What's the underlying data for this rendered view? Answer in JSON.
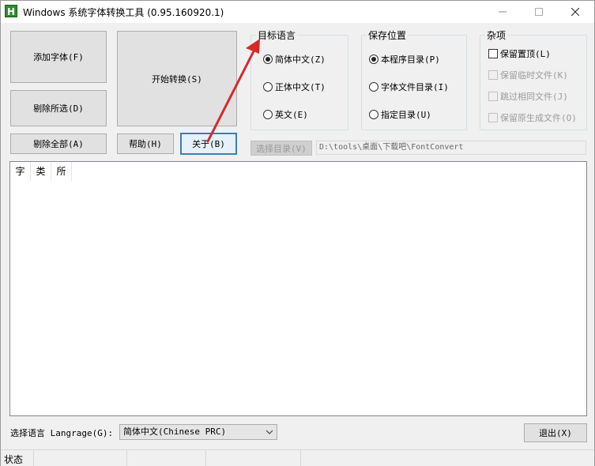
{
  "window": {
    "title": "Windows 系统字体转换工具 (0.95.160920.1)",
    "icon": "app-h-icon",
    "icon_glyph": "H",
    "controls": [
      "minimize-icon",
      "maximize-icon",
      "close-icon"
    ]
  },
  "buttons": {
    "add_font": "添加字体(F)",
    "start_convert": "开始转换(S)",
    "remove_selected": "剔除所选(D)",
    "remove_all": "剔除全部(A)",
    "help": "帮助(H)",
    "about": "关于(B)",
    "choose_dir": "选择目录(V)",
    "exit": "退出(X)"
  },
  "target_language": {
    "title": "目标语言",
    "options": [
      {
        "label": "简体中文(Z)",
        "selected": true
      },
      {
        "label": "正体中文(T)",
        "selected": false
      },
      {
        "label": "英文(E)",
        "selected": false
      }
    ]
  },
  "save_location": {
    "title": "保存位置",
    "options": [
      {
        "label": "本程序目录(P)",
        "selected": true
      },
      {
        "label": "字体文件目录(I)",
        "selected": false
      },
      {
        "label": "指定目录(U)",
        "selected": false
      }
    ]
  },
  "misc": {
    "title": "杂项",
    "options": [
      {
        "label": "保留置顶(L)",
        "checked": false,
        "enabled": true
      },
      {
        "label": "保留临时文件(K)",
        "checked": false,
        "enabled": false
      },
      {
        "label": "跳过相同文件(J)",
        "checked": false,
        "enabled": false
      },
      {
        "label": "保留原生成文件(O)",
        "checked": false,
        "enabled": false
      }
    ]
  },
  "output_path": "D:\\tools\\桌面\\下载吧\\FontConvert",
  "file_list": {
    "columns": [
      "字",
      "类",
      "所"
    ],
    "rows": []
  },
  "ui_language": {
    "label": "选择语言 Langrage(G):",
    "value": "简体中文(Chinese PRC)"
  },
  "statusbar": {
    "text": "状态"
  },
  "annotation": {
    "color": "#d42a2a"
  }
}
